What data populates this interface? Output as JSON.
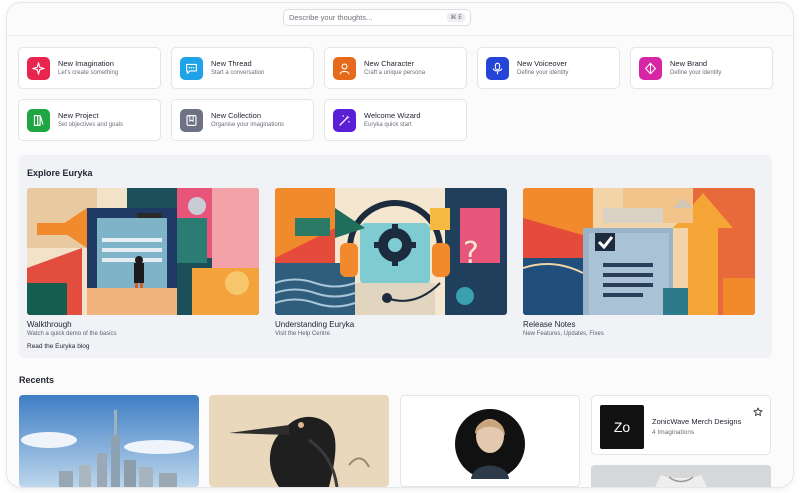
{
  "search": {
    "placeholder": "Describe your thoughts...",
    "shortcut": "⌘ E"
  },
  "quick_actions": [
    {
      "title": "New Imagination",
      "subtitle": "Let's create something",
      "icon": "sparkle-icon",
      "color": "#e8244f"
    },
    {
      "title": "New Thread",
      "subtitle": "Start a conversation",
      "icon": "chat-icon",
      "color": "#1fa2e8"
    },
    {
      "title": "New Character",
      "subtitle": "Craft a unique persona",
      "icon": "person-icon",
      "color": "#e56a1c"
    },
    {
      "title": "New Voiceover",
      "subtitle": "Define your identity",
      "icon": "microphone-icon",
      "color": "#2545d8"
    },
    {
      "title": "New Brand",
      "subtitle": "Define your identity",
      "icon": "brand-icon",
      "color": "#d626a6"
    },
    {
      "title": "New Project",
      "subtitle": "Set objectives and goals",
      "icon": "book-icon",
      "color": "#1fa542"
    },
    {
      "title": "New Collection",
      "subtitle": "Organise your imaginations",
      "icon": "bookmark-icon",
      "color": "#6d7285"
    },
    {
      "title": "Welcome Wizard",
      "subtitle": "Euryka quick start",
      "icon": "wand-icon",
      "color": "#5b1fd6"
    }
  ],
  "explore": {
    "title": "Explore Euryka",
    "cards": [
      {
        "title": "Walkthrough",
        "subtitle": "Watch a quick demo of the basics"
      },
      {
        "title": "Understanding Euryka",
        "subtitle": "Visit the Help Centre"
      },
      {
        "title": "Release Notes",
        "subtitle": "New Features, Updates, Fixes"
      }
    ],
    "blog_link": "Read the Euryka blog"
  },
  "recents": {
    "title": "Recents",
    "brand_card": {
      "logo_text": "Zo",
      "name": "ZonicWave Merch Designs",
      "count": "4 Imaginations"
    }
  }
}
